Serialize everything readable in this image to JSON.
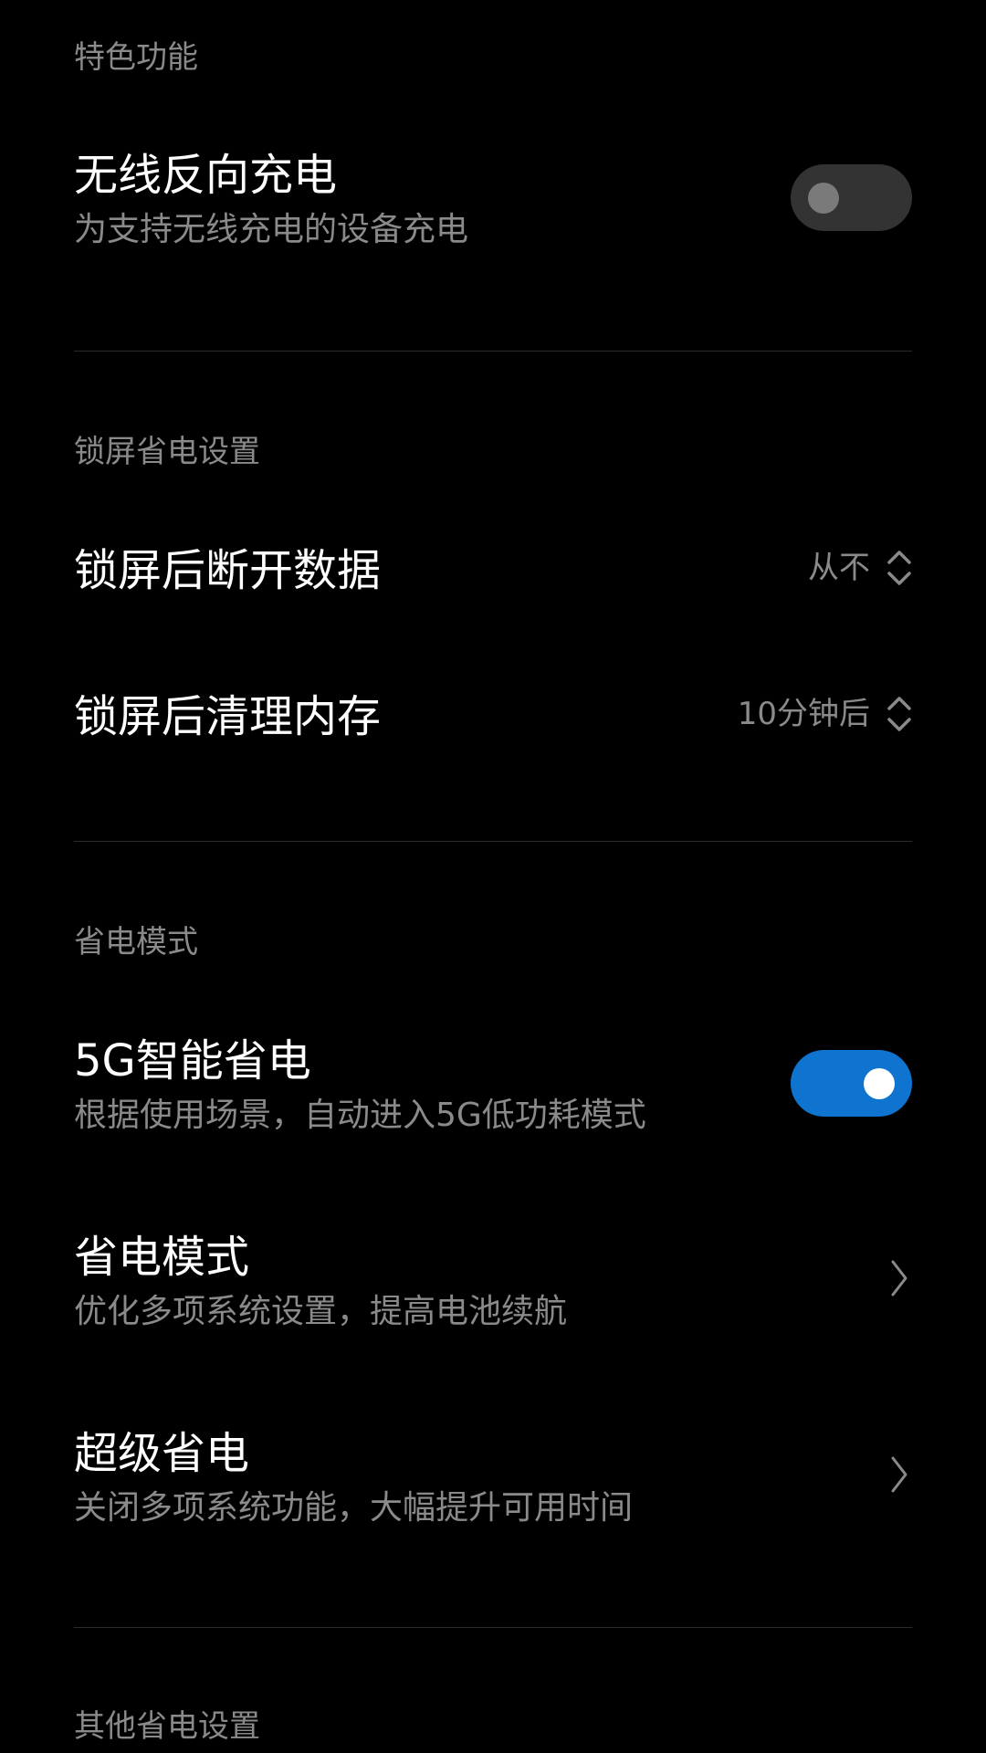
{
  "sections": {
    "featured": {
      "header": "特色功能",
      "wireless_reverse": {
        "title": "无线反向充电",
        "subtitle": "为支持无线充电的设备充电",
        "enabled": false
      }
    },
    "lockscreen": {
      "header": "锁屏省电设置",
      "disconnect_data": {
        "title": "锁屏后断开数据",
        "value": "从不"
      },
      "clear_memory": {
        "title": "锁屏后清理内存",
        "value": "10分钟后"
      }
    },
    "power_mode": {
      "header": "省电模式",
      "smart_5g": {
        "title": "5G智能省电",
        "subtitle": "根据使用场景，自动进入5G低功耗模式",
        "enabled": true
      },
      "battery_saver": {
        "title": "省电模式",
        "subtitle": "优化多项系统设置，提高电池续航"
      },
      "ultra_saver": {
        "title": "超级省电",
        "subtitle": "关闭多项系统功能，大幅提升可用时间"
      }
    },
    "other": {
      "header": "其他省电设置"
    }
  },
  "colors": {
    "background": "#000000",
    "toggle_on": "#0f74d0",
    "toggle_off": "#333333",
    "secondary_text": "#8a8a8a"
  },
  "icons": {
    "updown": "updown-arrows-icon",
    "chevron": "chevron-right-icon"
  }
}
